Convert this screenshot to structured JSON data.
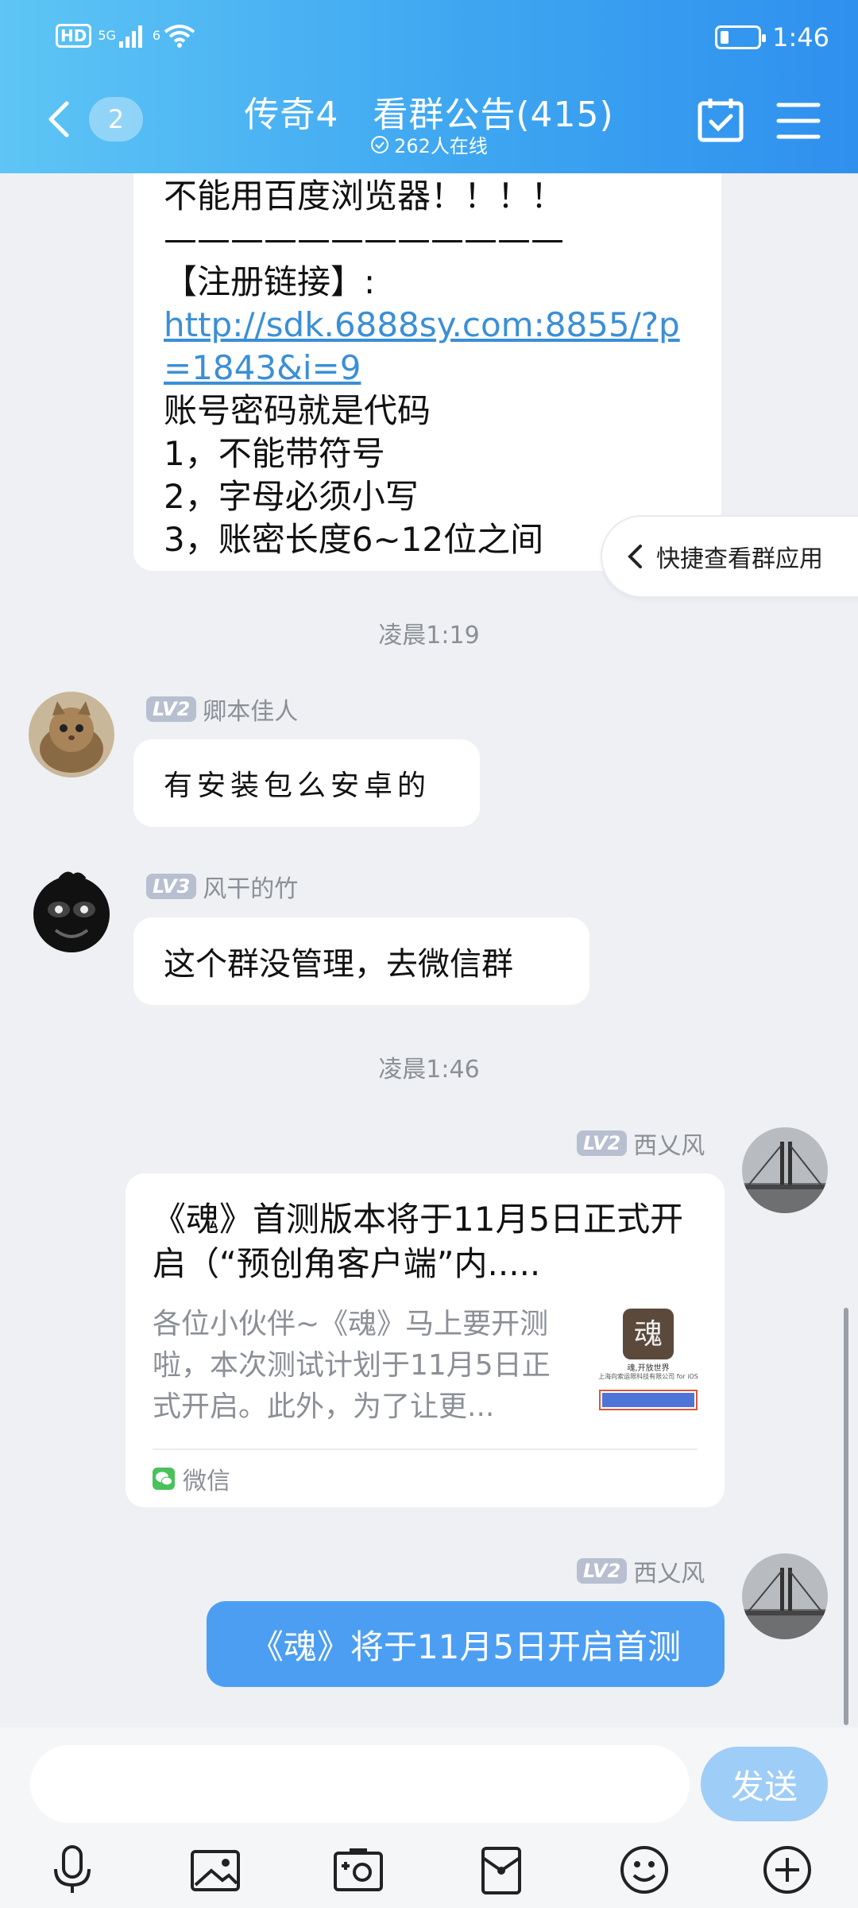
{
  "status_bar": {
    "hd": "HD",
    "network": "5G",
    "wifi_label": "6",
    "time": "1:46",
    "battery_level": 0.22
  },
  "nav": {
    "unread_count": "2",
    "group_name": "传奇4",
    "announcement": "看群公告(415)",
    "online_text": "262人在线"
  },
  "messages": {
    "announcement_lines": [
      "不能用百度浏览器！！！！",
      "————————————",
      "【注册链接】:",
      "http://sdk.6888sy.com:8855/?p=1843&i=9",
      "账号密码就是代码",
      "1，不能带符号",
      "2，字母必须小写",
      "3，账密长度6~12位之间"
    ],
    "time1": "凌晨1:19",
    "msg1": {
      "level": "LV2",
      "name": "卿本佳人",
      "text": "有安装包么安卓的"
    },
    "msg2": {
      "level": "LV3",
      "name": "风干的竹",
      "text": "这个群没管理，去微信群"
    },
    "time2": "凌晨1:46",
    "msg3": {
      "level": "LV2",
      "name": "西乂风",
      "card_title": "《魂》首测版本将于11月5日正式开启（“预创角客户端”内.....",
      "card_desc": "各位小伙伴~《魂》马上要开测啦，本次测试计划于11月5日正式开启。此外，为了让更...",
      "card_source": "微信",
      "thumb_caption": "魂,开放世界",
      "thumb_company": "上海向索运限科技有限公司 for iOS"
    },
    "msg4": {
      "level": "LV2",
      "name": "西乂风",
      "text": "《魂》将于11月5日开启首测"
    }
  },
  "quick_app": {
    "label": "快捷查看群应用"
  },
  "input": {
    "placeholder": "",
    "send_label": "发送"
  },
  "toolbar": {
    "icons": [
      "microphone-icon",
      "image-icon",
      "camera-icon",
      "red-packet-icon",
      "emoji-icon",
      "plus-icon"
    ]
  },
  "colors": {
    "header_start": "#5ec5f5",
    "header_end": "#2f90ee",
    "bubble_blue": "#4c9ef2",
    "link": "#3b8fd6",
    "send_disabled": "#9ecdf7"
  }
}
